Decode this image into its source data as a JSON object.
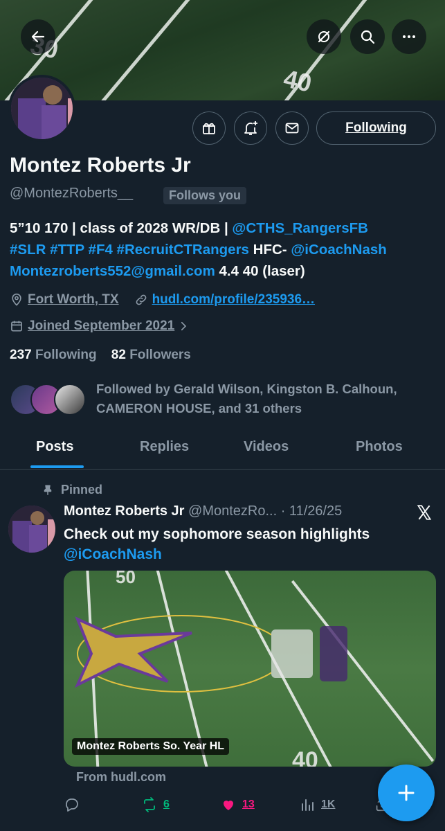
{
  "header": {
    "back_icon": "arrow-left-icon",
    "grok_icon": "grok-icon",
    "search_icon": "search-icon",
    "more_icon": "more-horizontal-icon",
    "banner_numbers": [
      "30",
      "40"
    ]
  },
  "actions": {
    "gift_icon": "gift-icon",
    "notify_icon": "bell-plus-icon",
    "message_icon": "envelope-icon",
    "following_label": "Following"
  },
  "profile": {
    "name": "Montez Roberts Jr",
    "handle": "@MontezRoberts__",
    "follows_you": "Follows you",
    "bio": {
      "part1": "5”10 170 | class of 2028 WR/DB | ",
      "mention1": "@CTHS_RangersFB",
      "hashtags": "#SLR #TTP #F4 #RecruitCTRangers",
      "part2": " HFC- ",
      "mention2": "@iCoachNash",
      "email": "Montezroberts552@gmail.com",
      "part3": " 4.4 40 (laser)"
    },
    "location": "Fort Worth, TX",
    "website": "hudl.com/profile/235936…",
    "joined": "Joined September 2021",
    "following_count": "237",
    "following_label": "Following",
    "followers_count": "82",
    "followers_label": "Followers",
    "followed_by": "Followed by Gerald Wilson, Kingston B. Calhoun, CAMERON HOUSE, and 31 others"
  },
  "tabs": [
    "Posts",
    "Replies",
    "Videos",
    "Photos"
  ],
  "post": {
    "pinned_label": "Pinned",
    "author_name": "Montez Roberts Jr",
    "author_handle": "@MontezRo...",
    "date": "· 11/26/25",
    "text": "Check out my sophomore season highlights",
    "mention": "@iCoachNash",
    "media_label": "Montez Roberts So. Year HL",
    "source": "From hudl.com",
    "media_field_numbers": [
      "50",
      "40"
    ],
    "stats": {
      "replies": "",
      "reposts": "6",
      "likes": "13",
      "views": "1K"
    }
  },
  "colors": {
    "background": "#15202b",
    "accent": "#1d9bf0",
    "muted": "#8b98a5",
    "repost": "#00ba7c",
    "like": "#f91880"
  }
}
